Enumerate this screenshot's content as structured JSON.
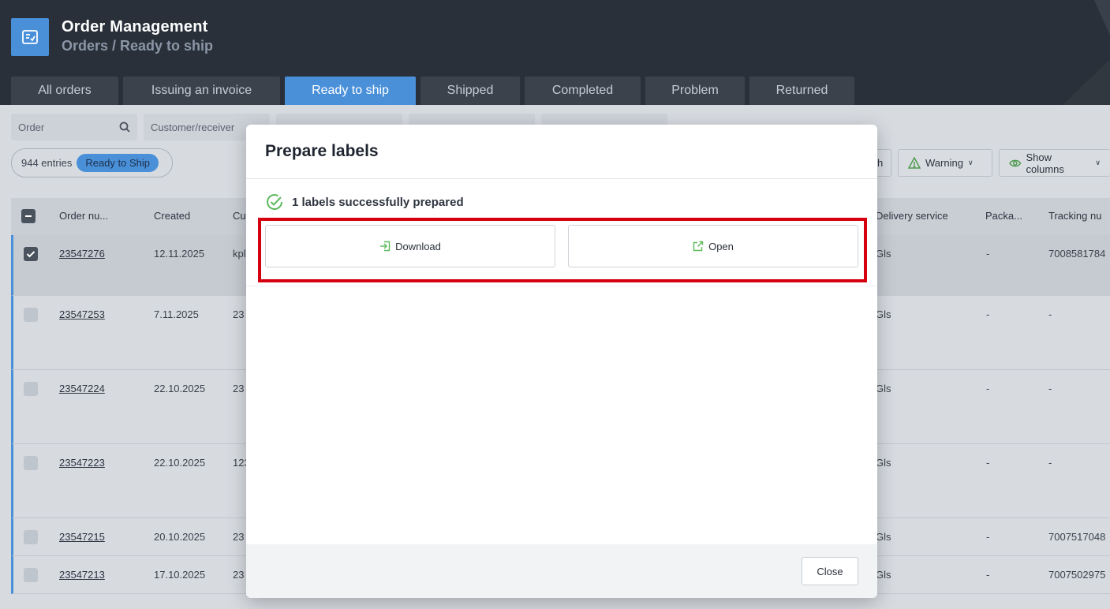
{
  "header": {
    "title": "Order Management",
    "breadcrumb": "Orders / Ready to ship"
  },
  "tabs": [
    {
      "label": "All orders"
    },
    {
      "label": "Issuing an invoice"
    },
    {
      "label": "Ready to ship",
      "active": true
    },
    {
      "label": "Shipped"
    },
    {
      "label": "Completed"
    },
    {
      "label": "Problem"
    },
    {
      "label": "Returned"
    }
  ],
  "filters": {
    "order_placeholder": "Order",
    "customer_placeholder": "Customer/receiver"
  },
  "toolbar": {
    "entries": "944 entries",
    "status_pill": "Ready to Ship",
    "search_fragment": "h",
    "warning_label": "Warning",
    "columns_label": "Show columns"
  },
  "table": {
    "columns": [
      "Order nu...",
      "Created",
      "Cu",
      "Delivery service",
      "Packa...",
      "Tracking nu"
    ],
    "rows": [
      {
        "order": "23547276",
        "created": "12.11.2025",
        "customer": "kpl",
        "service": "Gls",
        "package": "-",
        "tracking": "7008581784",
        "selected": true
      },
      {
        "order": "23547253",
        "created": "7.11.2025",
        "customer": "23",
        "service": "Gls",
        "package": "-",
        "tracking": "-"
      },
      {
        "order": "23547224",
        "created": "22.10.2025",
        "customer": "23",
        "service": "Gls",
        "package": "-",
        "tracking": "-"
      },
      {
        "order": "23547223",
        "created": "22.10.2025",
        "customer": "123",
        "service": "Gls",
        "package": "-",
        "tracking": "-"
      },
      {
        "order": "23547215",
        "created": "20.10.2025",
        "customer": "23",
        "service": "Gls",
        "package": "-",
        "tracking": "7007517048"
      },
      {
        "order": "23547213",
        "created": "17.10.2025",
        "customer": "23",
        "service": "Gls",
        "package": "-",
        "tracking": "7007502975"
      }
    ]
  },
  "modal": {
    "title": "Prepare labels",
    "success_message": "1 labels successfully prepared",
    "download_label": "Download",
    "open_label": "Open",
    "close_label": "Close"
  },
  "colors": {
    "accent": "#4a90d9",
    "success": "#5cb85c",
    "highlight": "#d4000f"
  }
}
